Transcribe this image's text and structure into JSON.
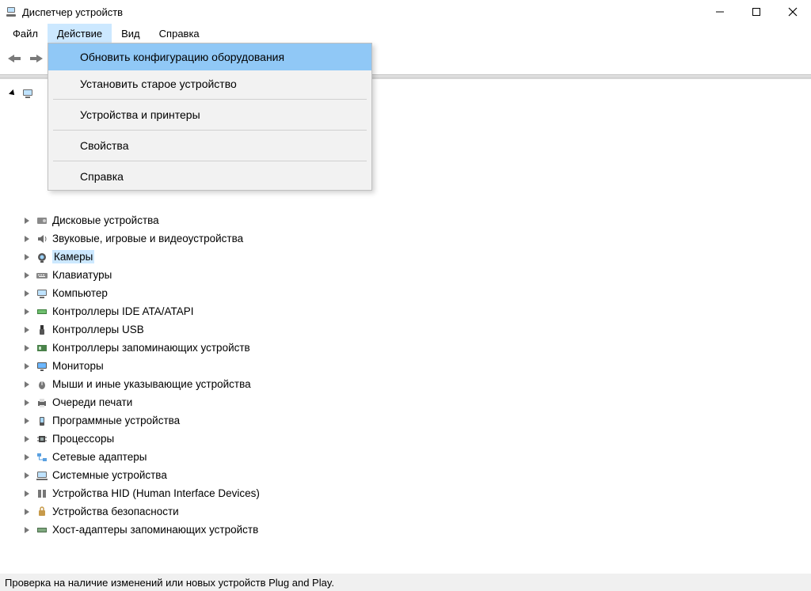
{
  "window": {
    "title": "Диспетчер устройств"
  },
  "menubar": [
    {
      "label": "Файл",
      "open": false
    },
    {
      "label": "Действие",
      "open": true
    },
    {
      "label": "Вид",
      "open": false
    },
    {
      "label": "Справка",
      "open": false
    }
  ],
  "action_menu": {
    "items": [
      {
        "label": "Обновить конфигурацию оборудования",
        "highlight": true
      },
      {
        "label": "Установить старое устройство"
      },
      {
        "sep": true
      },
      {
        "label": "Устройства и принтеры"
      },
      {
        "sep": true
      },
      {
        "label": "Свойства"
      },
      {
        "sep": true
      },
      {
        "label": "Справка"
      }
    ]
  },
  "tree": {
    "root_icon": "computer-icon",
    "root_label_hidden": true,
    "categories": [
      {
        "icon": "bluetooth-icon",
        "label": "",
        "obscured": true
      },
      {
        "icon": "dvd-icon",
        "label": "",
        "obscured": true
      },
      {
        "icon": "chip-icon",
        "label": "",
        "obscured": true
      },
      {
        "icon": "drive-icon",
        "label": "",
        "obscured": true
      },
      {
        "icon": "disk-icon",
        "label": "Дисковые устройства"
      },
      {
        "icon": "speaker-icon",
        "label": "Звуковые, игровые и видеоустройства"
      },
      {
        "icon": "camera-icon",
        "label": "Камеры",
        "selected": true
      },
      {
        "icon": "keyboard-icon",
        "label": "Клавиатуры"
      },
      {
        "icon": "pc-icon",
        "label": "Компьютер"
      },
      {
        "icon": "ide-icon",
        "label": "Контроллеры IDE ATA/ATAPI"
      },
      {
        "icon": "usb-icon",
        "label": "Контроллеры USB"
      },
      {
        "icon": "storage-ctrl-icon",
        "label": "Контроллеры запоминающих устройств"
      },
      {
        "icon": "monitor-icon",
        "label": "Мониторы"
      },
      {
        "icon": "mouse-icon",
        "label": "Мыши и иные указывающие устройства"
      },
      {
        "icon": "printer-icon",
        "label": "Очереди печати"
      },
      {
        "icon": "software-icon",
        "label": "Программные устройства"
      },
      {
        "icon": "cpu-icon",
        "label": "Процессоры"
      },
      {
        "icon": "network-icon",
        "label": "Сетевые адаптеры"
      },
      {
        "icon": "system-icon",
        "label": "Системные устройства"
      },
      {
        "icon": "hid-icon",
        "label": "Устройства HID (Human Interface Devices)"
      },
      {
        "icon": "security-icon",
        "label": "Устройства безопасности"
      },
      {
        "icon": "host-adapter-icon",
        "label": "Хост-адаптеры запоминающих устройств"
      }
    ]
  },
  "statusbar": {
    "text": "Проверка на наличие изменений или новых устройств Plug and Play."
  }
}
